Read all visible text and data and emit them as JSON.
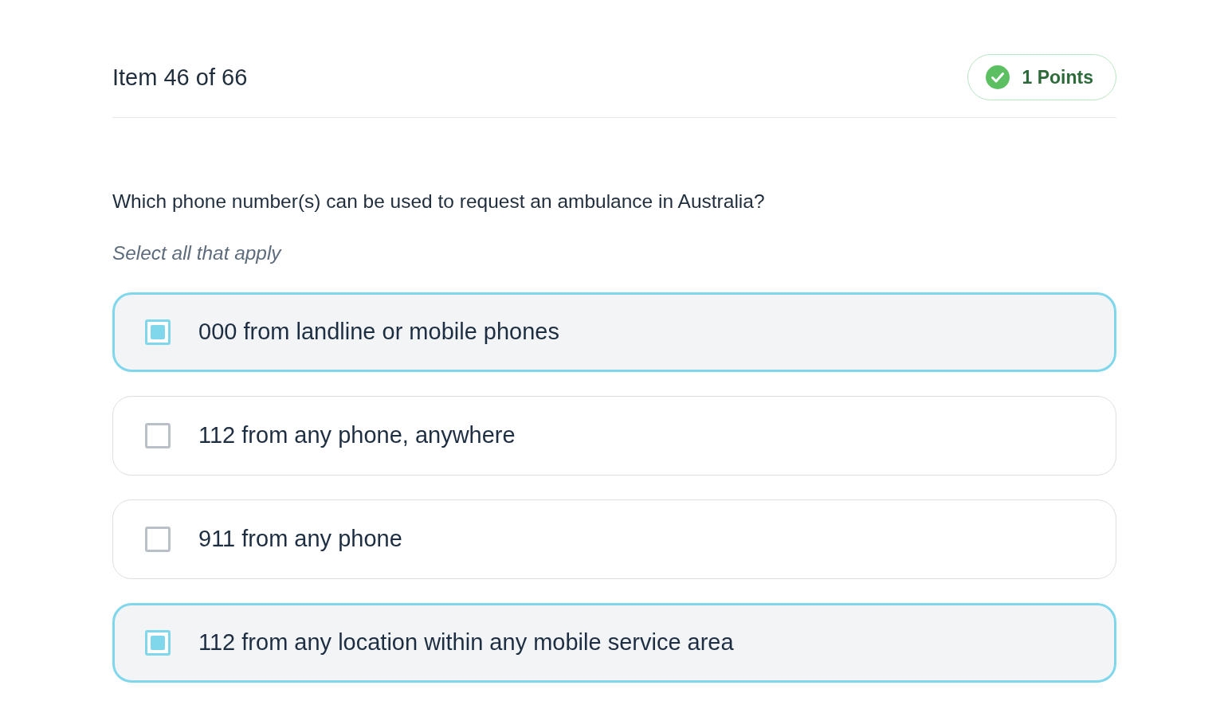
{
  "header": {
    "title": "Item 46 of 66",
    "points": "1 Points"
  },
  "question": {
    "text": "Which phone number(s) can be used to request an ambulance in Australia?",
    "instruction": "Select all that apply"
  },
  "options": [
    {
      "label": "000 from landline or mobile phones",
      "selected": true
    },
    {
      "label": "112 from any phone, anywhere",
      "selected": false
    },
    {
      "label": "911 from any phone",
      "selected": false
    },
    {
      "label": "112 from any location within any mobile service area",
      "selected": true
    }
  ]
}
